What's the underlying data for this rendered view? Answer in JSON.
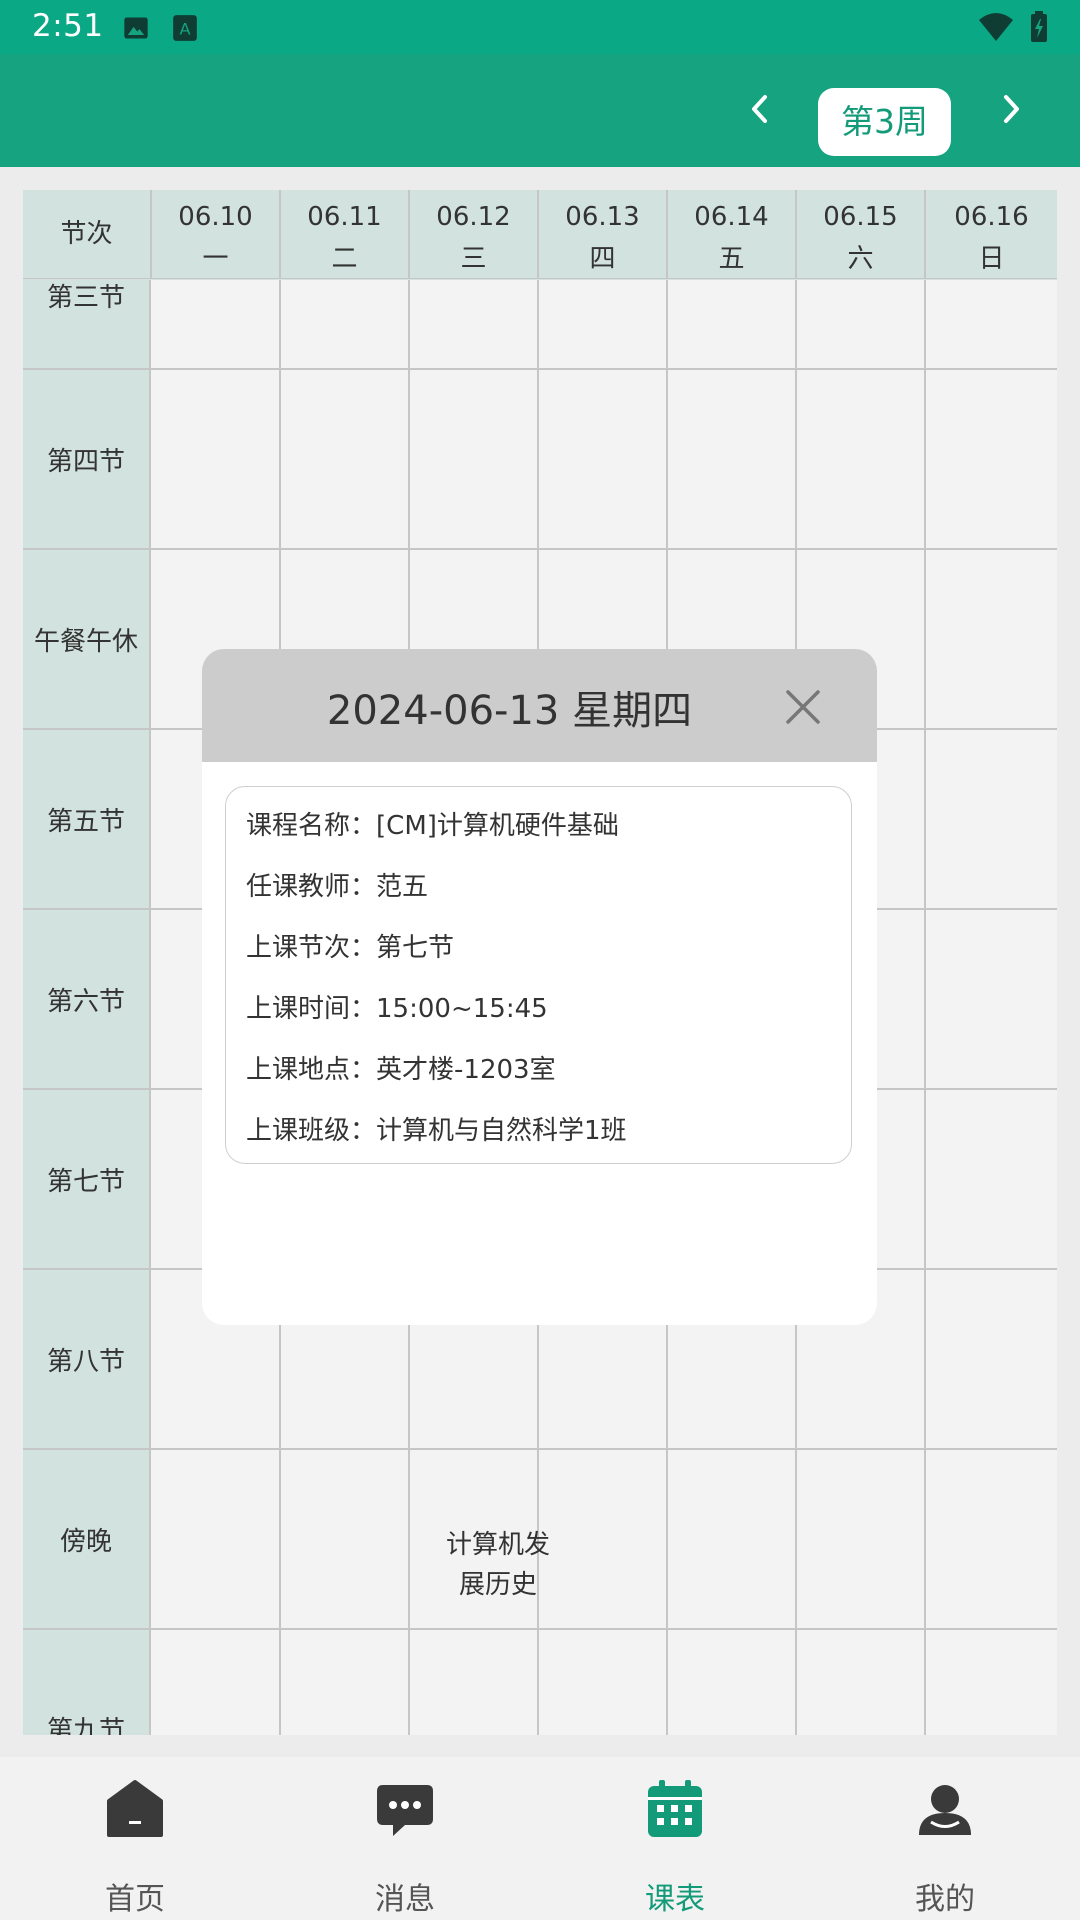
{
  "status_bar": {
    "time": "2:51"
  },
  "header": {
    "week_label": "第3周"
  },
  "timetable": {
    "corner_label": "节次",
    "days": [
      {
        "date": "06.10",
        "weekday": "一"
      },
      {
        "date": "06.11",
        "weekday": "二"
      },
      {
        "date": "06.12",
        "weekday": "三"
      },
      {
        "date": "06.13",
        "weekday": "四"
      },
      {
        "date": "06.14",
        "weekday": "五"
      },
      {
        "date": "06.15",
        "weekday": "六"
      },
      {
        "date": "06.16",
        "weekday": "日"
      }
    ],
    "periods": [
      "第三节",
      "第四节",
      "午餐午休",
      "第五节",
      "第六节",
      "第七节",
      "第八节",
      "傍晚",
      "第九节"
    ],
    "visible_course": {
      "name": "计算机发展历史"
    }
  },
  "dialog": {
    "title": "2024-06-13  星期四",
    "fields": [
      {
        "key": "课程名称：",
        "value": "[CM]计算机硬件基础"
      },
      {
        "key": "任课教师：",
        "value": "范五"
      },
      {
        "key": "上课节次：",
        "value": "第七节"
      },
      {
        "key": "上课时间：",
        "value": "15:00~15:45"
      },
      {
        "key": "上课地点：",
        "value": "英才楼-1203室"
      },
      {
        "key": "上课班级：",
        "value": "计算机与自然科学1班"
      }
    ]
  },
  "bottom_nav": {
    "items": [
      {
        "label": "首页",
        "icon": "home-icon"
      },
      {
        "label": "消息",
        "icon": "message-icon"
      },
      {
        "label": "课表",
        "icon": "calendar-icon",
        "active": true
      },
      {
        "label": "我的",
        "icon": "user-icon"
      }
    ]
  },
  "colors": {
    "primary": "#16a380",
    "status_bar": "#0aa884",
    "accent_text": "#139a78",
    "table_header_bg": "#d2e2de",
    "dialog_header_bg": "#cccccc"
  }
}
